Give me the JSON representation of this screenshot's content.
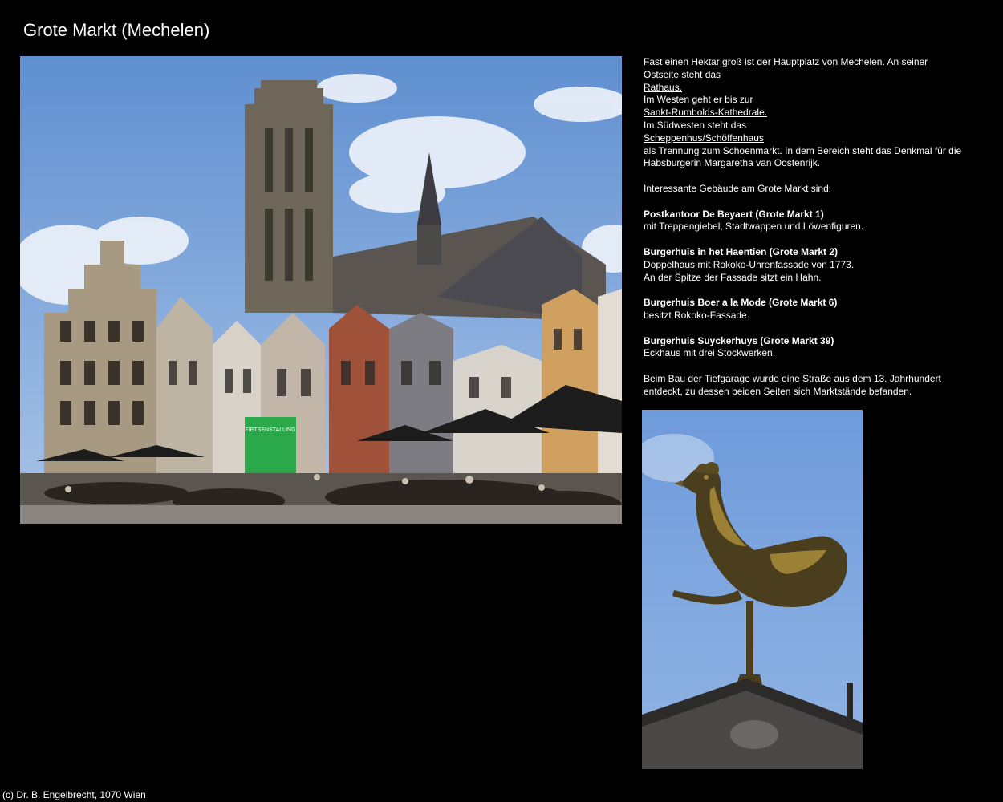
{
  "page": {
    "title": "Grote Markt (Mechelen)"
  },
  "description": {
    "intro_1": "Fast einen Hektar groß ist der Hauptplatz von Mechelen. An seiner Ostseite steht das",
    "link_rathaus": "Rathaus.",
    "intro_2": "Im Westen geht er bis zur",
    "link_kathedrale": "Sankt-Rumbolds-Kathedrale.",
    "intro_3": "Im Südwesten steht das",
    "link_scheppenhus": "Scheppenhus/Schöffenhaus",
    "intro_4": "als Trennung zum Schoenmarkt. In dem Bereich steht das Denkmal für die Habsburgerin Margaretha van Oostenrijk.",
    "buildings_heading": "Interessante Gebäude am Grote Markt sind:",
    "buildings": [
      {
        "name": "Postkantoor De Beyaert (Grote Markt 1)",
        "lines": [
          "mit Treppengiebel, Stadtwappen und Löwenfiguren."
        ]
      },
      {
        "name": "Burgerhuis in het Haentien (Grote Markt 2)",
        "lines": [
          "Doppelhaus mit Rokoko-Uhrenfassade von 1773.",
          "An der Spitze der Fassade sitzt ein Hahn."
        ]
      },
      {
        "name": "Burgerhuis Boer a la Mode (Grote Markt 6)",
        "lines": [
          "besitzt Rokoko-Fassade."
        ]
      },
      {
        "name": "Burgerhuis Suyckerhuys (Grote Markt 39)",
        "lines": [
          "Eckhaus mit drei Stockwerken."
        ]
      }
    ],
    "closing": "Beim Bau der Tiefgarage wurde eine Straße aus dem 13. Jahrhundert entdeckt, zu dessen beiden Seiten sich Marktstände befanden."
  },
  "photo_main": {
    "sign_text": "FIETSENSTALLING"
  },
  "footer": {
    "copyright": "(c) Dr. B. Engelbrecht, 1070 Wien"
  },
  "colors": {
    "background": "#000000",
    "text": "#ffffff",
    "sky": "#6f9ad6",
    "sky_rooster": "#7fa6de",
    "stone": "#8a7f6e"
  }
}
